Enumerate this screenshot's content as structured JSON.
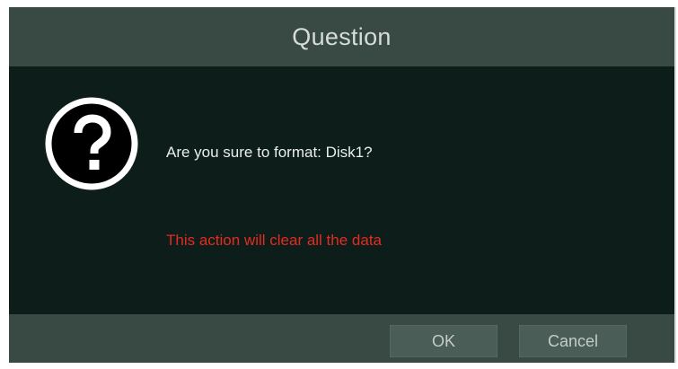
{
  "dialog": {
    "title": "Question",
    "icon": "question-mark-circle-icon",
    "message": "Are you sure to format: Disk1?",
    "warning": "This action will clear all the data",
    "buttons": {
      "ok_label": "OK",
      "cancel_label": "Cancel"
    }
  },
  "colors": {
    "dialog_frame": "#394a44",
    "body_background": "#0d1d1a",
    "warning_text": "#e32b22",
    "button_background": "#4b5d57"
  }
}
